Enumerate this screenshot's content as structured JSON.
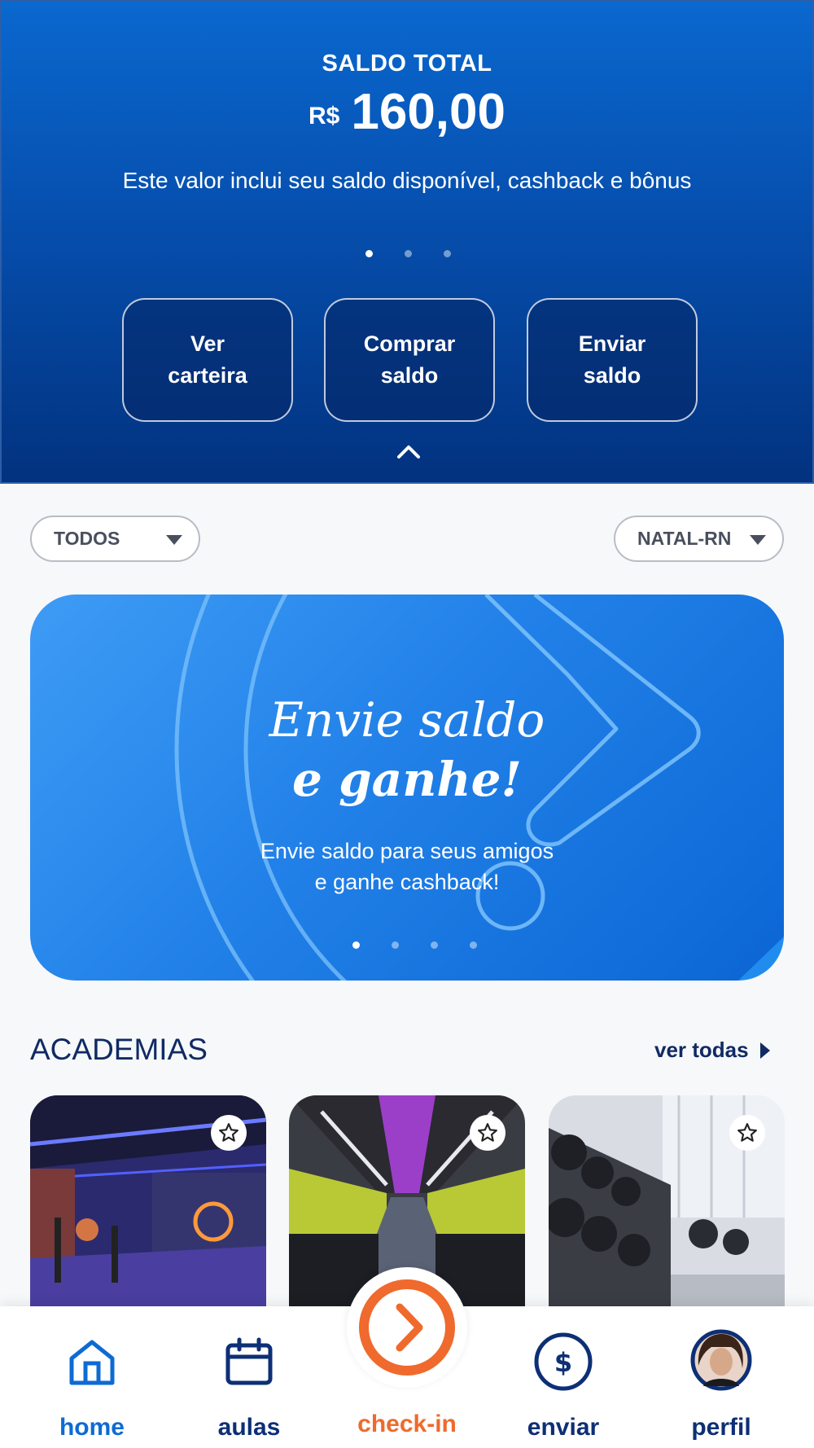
{
  "balance": {
    "title": "SALDO TOTAL",
    "currency": "R$",
    "amount": "160,00",
    "description": "Este valor inclui seu saldo disponível, cashback e bônus",
    "active_page": 1,
    "page_count": 3
  },
  "actions": [
    {
      "label_line1": "Ver",
      "label_line2": "carteira"
    },
    {
      "label_line1": "Comprar",
      "label_line2": "saldo"
    },
    {
      "label_line1": "Enviar",
      "label_line2": "saldo"
    }
  ],
  "filters": {
    "category": "TODOS",
    "city": "NATAL-RN"
  },
  "banner": {
    "title_line1": "Envie saldo",
    "title_line2": "e ganhe!",
    "text_line1": "Envie saldo para seus amigos",
    "text_line2": "e ganhe cashback!",
    "active_page": 1,
    "page_count": 4
  },
  "gyms_section": {
    "title": "ACADEMIAS",
    "see_all": "ver todas",
    "cards": [
      {
        "icon": "star-icon",
        "favorite": false
      },
      {
        "icon": "star-icon",
        "favorite": false
      },
      {
        "icon": "star-icon",
        "favorite": false
      }
    ]
  },
  "bottom_nav": [
    {
      "label": "home",
      "icon": "home-icon",
      "active": true
    },
    {
      "label": "aulas",
      "icon": "calendar-icon",
      "active": false
    },
    {
      "label": "check-in",
      "icon": "chevron-right-icon",
      "active": false
    },
    {
      "label": "enviar",
      "icon": "dollar-icon",
      "active": false
    },
    {
      "label": "perfil",
      "icon": "avatar",
      "active": false
    }
  ],
  "colors": {
    "primary_blue": "#0a68cf",
    "dark_navy": "#102a63",
    "checkin_orange": "#ef6a2c",
    "background": "#f7f8fa"
  }
}
